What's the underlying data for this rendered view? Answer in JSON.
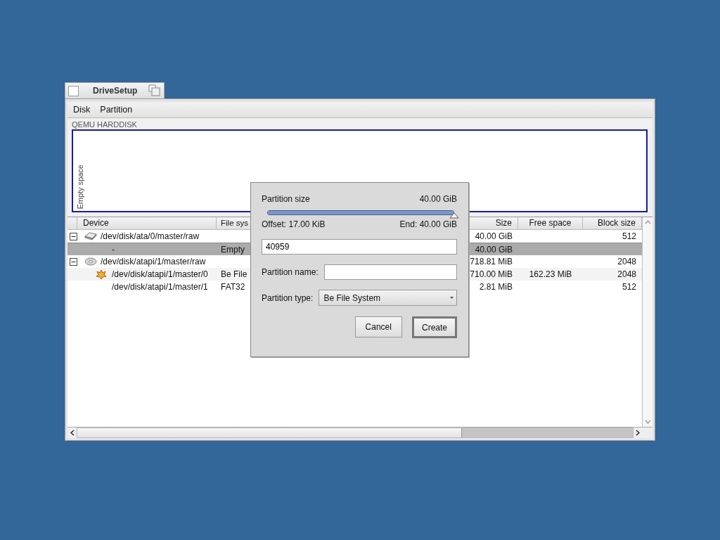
{
  "window": {
    "title": "DriveSetup"
  },
  "menu": [
    "Disk",
    "Partition"
  ],
  "disk_map": {
    "label": "QEMU HARDDISK",
    "segments": [
      {
        "label": "Empty space",
        "selected": true
      }
    ]
  },
  "table": {
    "columns": [
      "Device",
      "File sys",
      "Size",
      "Free space",
      "Block size"
    ],
    "rows": [
      {
        "kind": "harddisk",
        "device": "/dev/disk/ata/0/master/raw",
        "size": "40.00 GiB",
        "block_size": "512",
        "expanded": true,
        "selected": false,
        "children": [
          {
            "kind": "empty",
            "device": "-",
            "file_system": "Empty",
            "size": "40.00 GiB",
            "selected": true
          }
        ]
      },
      {
        "kind": "cdrom",
        "device": "/dev/disk/atapi/1/master/raw",
        "size": "718.81 MiB",
        "block_size": "2048",
        "expanded": true,
        "selected": false,
        "children": [
          {
            "kind": "bfs",
            "device": "/dev/disk/atapi/1/master/0",
            "file_system": "Be File",
            "size": "710.00 MiB",
            "free_space": "162.23 MiB",
            "block_size": "2048",
            "selected": false
          },
          {
            "kind": "plain",
            "device": "/dev/disk/atapi/1/master/1",
            "file_system": "FAT32",
            "size": "2.81 MiB",
            "block_size": "512",
            "selected": false
          }
        ]
      }
    ]
  },
  "dialog": {
    "size_label": "Partition size",
    "size_value": "40.00 GiB",
    "level": 1.0,
    "offset": "Offset: 17.00 KiB",
    "end": "End: 40.00 GiB",
    "size_input": "40959",
    "name_label": "Partition name:",
    "type_label": "Partition type:",
    "type_value": "Be File System",
    "buttons": [
      {
        "label": "Cancel",
        "default": false
      },
      {
        "label": "Create",
        "default": true
      }
    ]
  }
}
